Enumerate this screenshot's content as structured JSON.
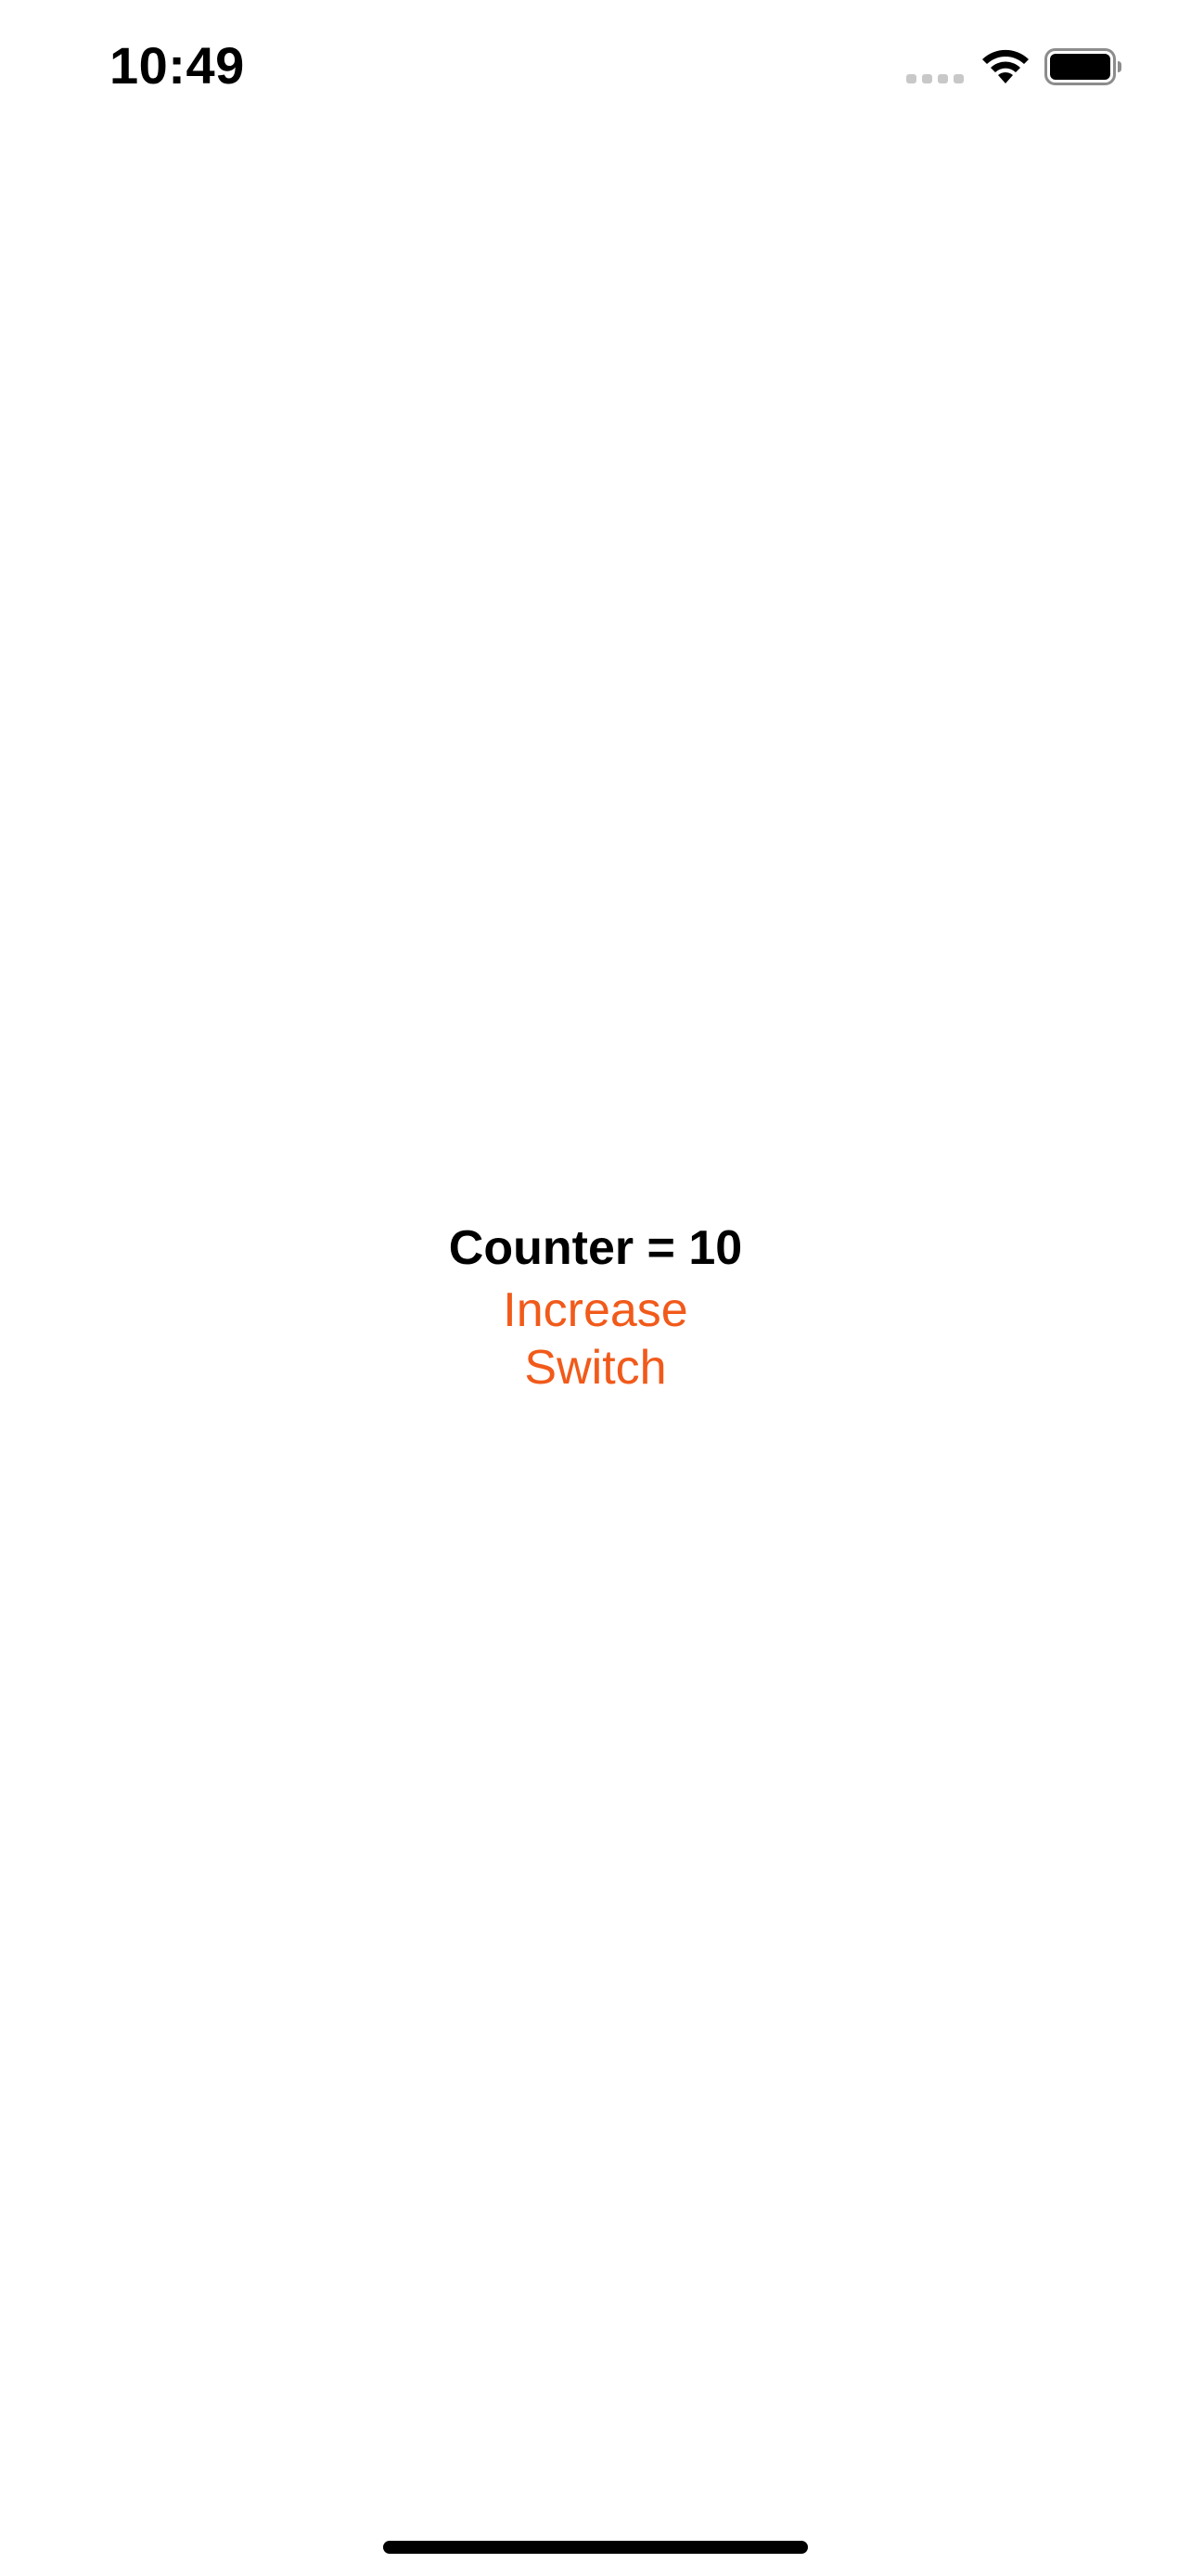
{
  "status_bar": {
    "time": "10:49",
    "signal_icon": "cellular-signal-icon",
    "wifi_icon": "wifi-icon",
    "battery_icon": "battery-icon"
  },
  "main": {
    "counter_text": "Counter = 10",
    "increase_label": "Increase",
    "switch_label": "Switch"
  },
  "colors": {
    "accent": "#F15A1A",
    "text": "#000000",
    "background": "#FFFFFF",
    "signal_inactive": "#C8C8C8"
  }
}
